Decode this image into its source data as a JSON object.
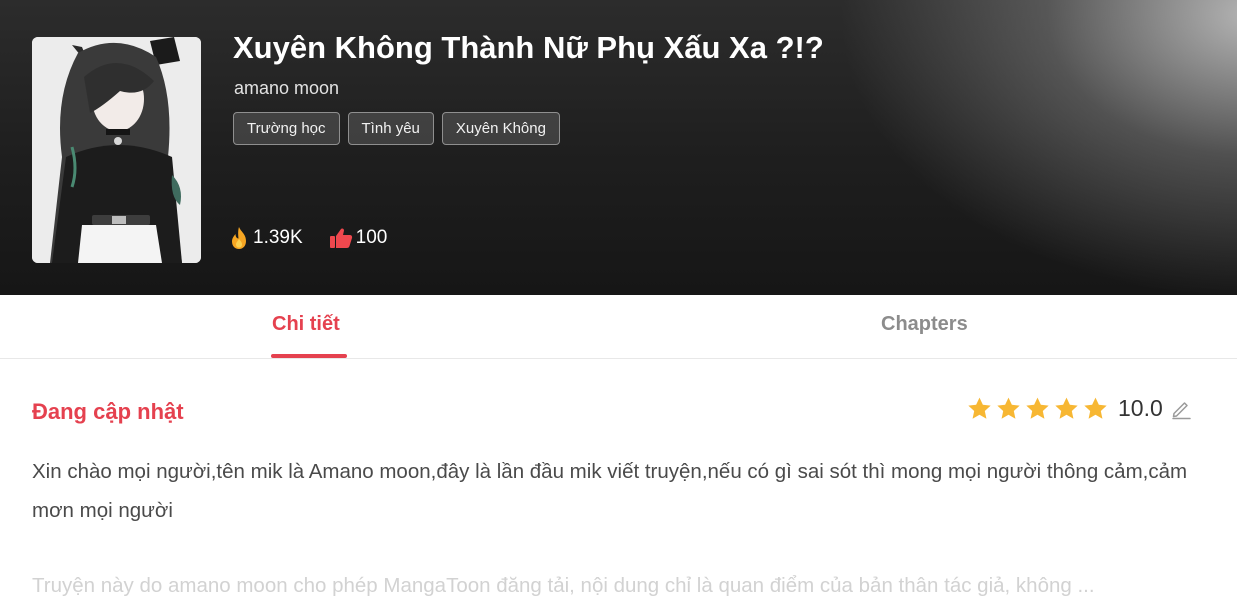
{
  "header": {
    "title": "Xuyên Không Thành Nữ Phụ Xấu Xa ?!?",
    "author": "amano moon",
    "tags": [
      "Trường học",
      "Tình yêu",
      "Xuyên Không"
    ],
    "stats": {
      "views": "1.39K",
      "views_icon": "fire-icon",
      "likes": "100",
      "likes_icon": "thumbs-up-icon"
    }
  },
  "tabs": {
    "details": "Chi tiết",
    "chapters": "Chapters",
    "active": "details"
  },
  "details": {
    "status": "Đang cập nhật",
    "rating": {
      "stars": 5,
      "value": "10.0"
    },
    "description": "Xin chào mọi người,tên mik là Amano moon,đây là lần đầu mik viết truyện,nếu có gì sai sót thì mong mọi người thông cảm,cảm mơn mọi người",
    "disclaimer": "Truyện này do amano moon cho phép MangaToon đăng tải, nội dung chỉ là quan điểm của bản thân tác giả, không ..."
  },
  "colors": {
    "accent": "#e5414f",
    "star": "#f7b733",
    "fire": "#f6a623",
    "like": "#f0484e"
  }
}
